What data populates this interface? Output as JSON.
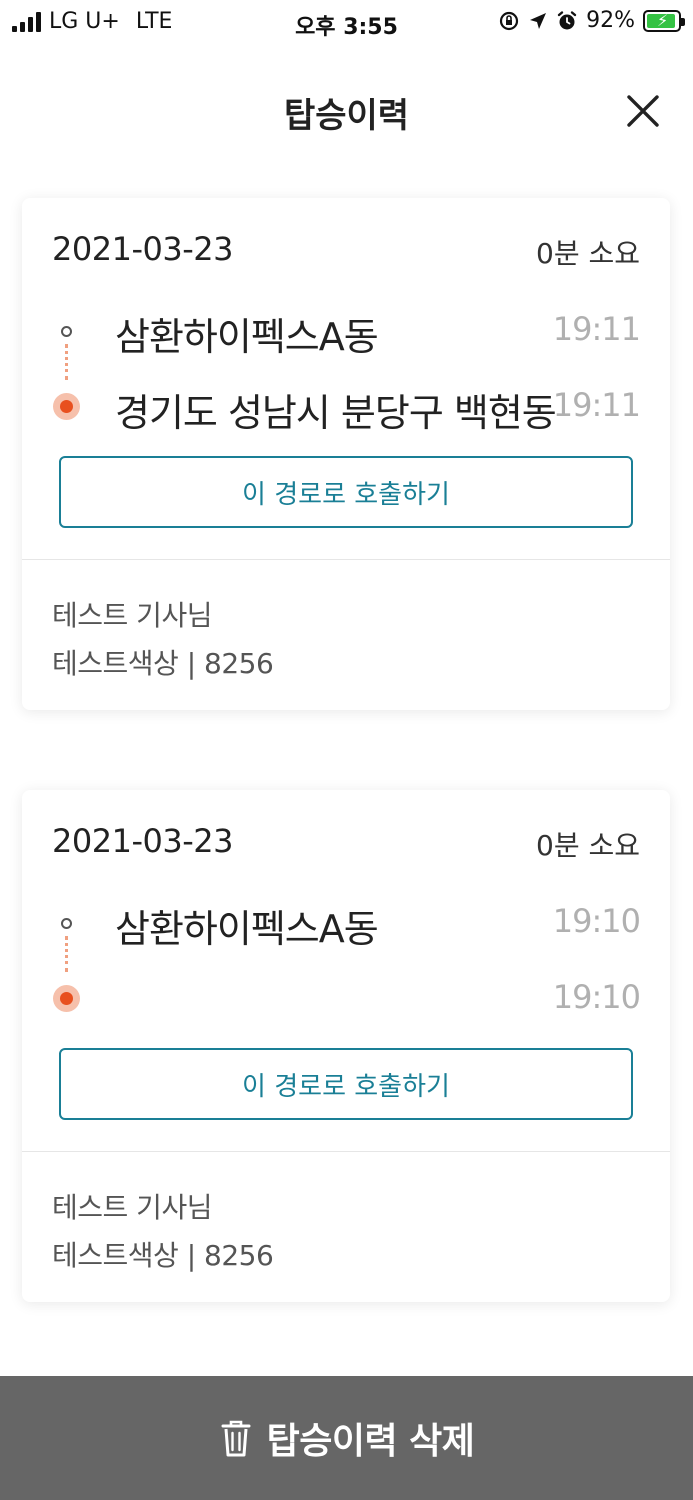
{
  "status_bar": {
    "carrier": "LG U+",
    "network": "LTE",
    "time": "오후 3:55",
    "battery_percent": "92%",
    "battery_level": 0.92
  },
  "header": {
    "title": "탑승이력"
  },
  "trips": [
    {
      "date": "2021-03-23",
      "duration": "0분 소요",
      "origin_name": "삼환하이펙스A동",
      "origin_time": "19:11",
      "destination_name": "경기도 성남시 분당구 백현동",
      "destination_time": "19:11",
      "call_label": "이 경로로 호출하기",
      "driver": "테스트 기사님",
      "car": "테스트색상 | 8256"
    },
    {
      "date": "2021-03-23",
      "duration": "0분 소요",
      "origin_name": "삼환하이펙스A동",
      "origin_time": "19:10",
      "destination_name": "",
      "destination_time": "19:10",
      "call_label": "이 경로로 호출하기",
      "driver": "테스트 기사님",
      "car": "테스트색상 | 8256"
    }
  ],
  "footer": {
    "delete_label": "탑승이력 삭제"
  },
  "colors": {
    "accent": "#1a7f96",
    "destination_marker": "#e8501f",
    "delete_bar": "#666666",
    "battery_fill": "#35c244"
  }
}
